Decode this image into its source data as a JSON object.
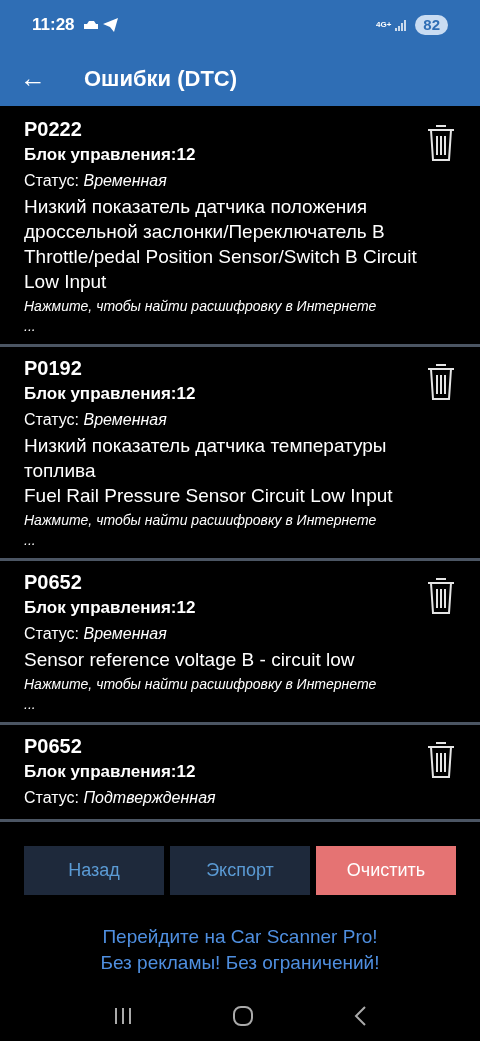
{
  "status_bar": {
    "time": "11:28",
    "network": "4G+",
    "battery": "82"
  },
  "toolbar": {
    "back": "←",
    "title": "Ошибки (DTC)"
  },
  "errors": [
    {
      "code": "P0222",
      "block": "Блок управления:12",
      "status_label": "Статус:",
      "status": "Временная",
      "description": "Низкий показатель датчика положения дроссельной заслонки/Переключатель B\nThrottle/pedal Position Sensor/Switch B Circuit Low Input",
      "hint": "Нажмите, чтобы найти расшифровку в Интернете ..."
    },
    {
      "code": "P0192",
      "block": "Блок управления:12",
      "status_label": "Статус:",
      "status": "Временная",
      "description": "Низкий показатель датчика температуры топлива\nFuel Rail Pressure Sensor Circuit Low Input",
      "hint": "Нажмите, чтобы найти расшифровку в Интернете ..."
    },
    {
      "code": "P0652",
      "block": "Блок управления:12",
      "status_label": "Статус:",
      "status": "Временная",
      "description": "Sensor reference voltage B - circuit low",
      "hint": "Нажмите, чтобы найти расшифровку в Интернете ..."
    },
    {
      "code": "P0652",
      "block": "Блок управления:12",
      "status_label": "Статус:",
      "status": "Подтвержденная"
    }
  ],
  "buttons": [
    {
      "label": "Назад",
      "kind": "secondary"
    },
    {
      "label": "Экспорт",
      "kind": "secondary"
    },
    {
      "label": "Очистить",
      "kind": "danger"
    }
  ],
  "promo": [
    "Перейдите на Car Scanner Pro!",
    "Без рекламы! Без ограничений!"
  ]
}
